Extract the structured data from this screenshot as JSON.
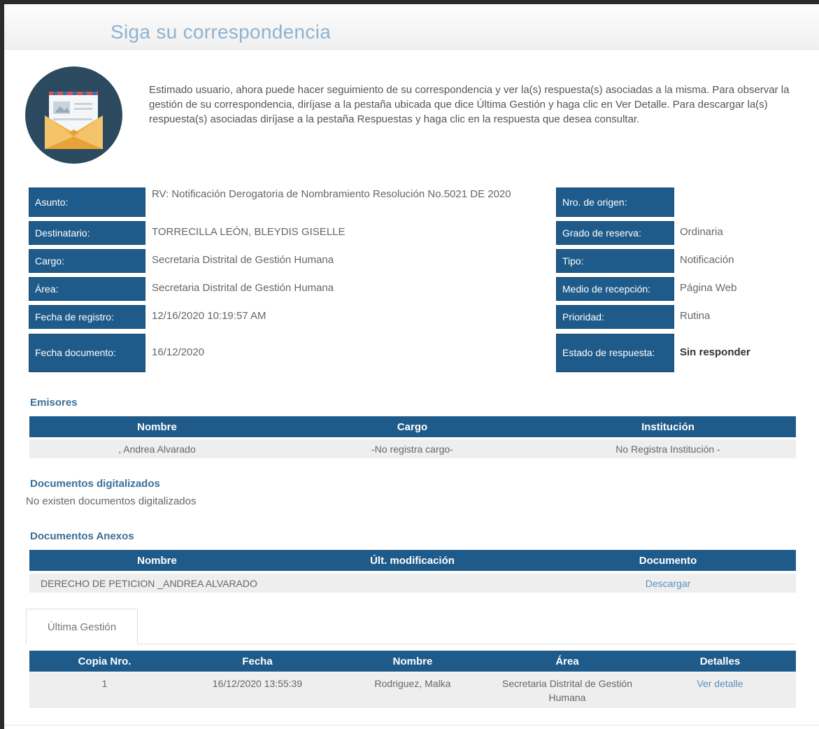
{
  "page": {
    "title": "Siga su correspondencia",
    "intro": "Estimado usuario, ahora puede hacer seguimiento de su correspondencia y ver la(s) respuesta(s) asociadas a la misma. Para observar la gestión de su correspondencia, diríjase a la pestaña ubicada que dice Última Gestión y haga clic en Ver Detalle. Para descargar la(s) respuesta(s) asociadas diríjase a la pestaña Respuestas y haga clic en la respuesta que desea consultar."
  },
  "details_left": [
    {
      "label": "Asunto:",
      "value": "RV: Notificación Derogatoria de Nombramiento Resolución No.5021 DE 2020"
    },
    {
      "label": "Destinatario:",
      "value": "TORRECILLA LEÓN, BLEYDIS GISELLE"
    },
    {
      "label": "Cargo:",
      "value": "Secretaria Distrital de Gestión Humana"
    },
    {
      "label": "Área:",
      "value": "Secretaria Distrital de Gestión Humana"
    },
    {
      "label": "Fecha de registro:",
      "value": "12/16/2020 10:19:57 AM"
    },
    {
      "label": "Fecha documento:",
      "value": "16/12/2020"
    }
  ],
  "details_right": [
    {
      "label": "Nro. de origen:",
      "value": ""
    },
    {
      "label": "Grado de reserva:",
      "value": "Ordinaria"
    },
    {
      "label": "Tipo:",
      "value": "Notificación"
    },
    {
      "label": "Medio de recepción:",
      "value": "Página Web"
    },
    {
      "label": "Prioridad:",
      "value": "Rutina"
    },
    {
      "label": "Estado de respuesta:",
      "value": "Sin responder"
    }
  ],
  "emisores": {
    "title": "Emisores",
    "headers": [
      "Nombre",
      "Cargo",
      "Institución"
    ],
    "rows": [
      [
        ", Andrea Alvarado",
        "-No registra cargo-",
        "No Registra Institución -"
      ]
    ]
  },
  "documentos_digitalizados": {
    "title": "Documentos digitalizados",
    "message": "No existen documentos digitalizados"
  },
  "documentos_anexos": {
    "title": "Documentos Anexos",
    "headers": [
      "Nombre",
      "Últ. modificación",
      "Documento"
    ],
    "rows": [
      {
        "nombre": "DERECHO DE PETICION _ANDREA ALVARADO",
        "modificacion": "",
        "documento": "Descargar"
      }
    ]
  },
  "ultima_gestion": {
    "tab_label": "Última Gestión",
    "headers": [
      "Copia Nro.",
      "Fecha",
      "Nombre",
      "Área",
      "Detalles"
    ],
    "rows": [
      {
        "copia": "1",
        "fecha": "16/12/2020 13:55:39",
        "nombre": "Rodriguez, Malka",
        "area": "Secretaria Distrital de Gestión Humana",
        "detalles": "Ver detalle"
      }
    ]
  },
  "colors": {
    "header_blue": "#1f5b8a",
    "title_blue": "#8fb3cf",
    "section_blue": "#3a6f99",
    "link_blue": "#5a90c0"
  },
  "icons": {
    "avatar": "envelope-letter-icon"
  }
}
